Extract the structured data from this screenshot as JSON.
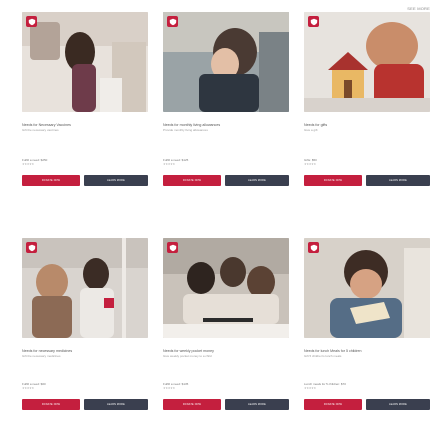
{
  "header": {
    "see_more": "SEE MORE"
  },
  "icons": {
    "badge": "shield-heart-icon"
  },
  "colors": {
    "brand": "#c41f3e",
    "secondary_button": "#3a3f4f"
  },
  "cards": [
    {
      "title": "Needs for Necessary Vaccines",
      "subtitle": "Gift the necessary vaccines",
      "price": "Fulfill a need: $250",
      "stars": "★★★★★",
      "primary": "DONATE NOW",
      "secondary": "LEARN MORE"
    },
    {
      "title": "Needs for monthly living allowances",
      "subtitle": "Provide monthly living allowances",
      "price": "Fulfill a need: $125",
      "stars": "★★★★★",
      "primary": "DONATE NOW",
      "secondary": "LEARN MORE"
    },
    {
      "title": "Needs for gifts",
      "subtitle": "Give a gift",
      "price": "Gifts: $50",
      "stars": "★★★★★",
      "primary": "DONATE NOW",
      "secondary": "LEARN MORE"
    },
    {
      "title": "Needs for necessary medicines",
      "subtitle": "Gift the necessary medicines",
      "price": "Fulfill a need: $60",
      "stars": "★★★★★",
      "primary": "DONATE NOW",
      "secondary": "LEARN MORE"
    },
    {
      "title": "Needs for weekly pocket money",
      "subtitle": "Give weekly pocket money to a child",
      "price": "Fulfill a need: $135",
      "stars": "★★★★★",
      "primary": "DONATE NOW",
      "secondary": "LEARN MORE"
    },
    {
      "title": "Needs for lunch Meals for 5 children",
      "subtitle": "Gift 5 children's lunch meals",
      "price": "Lunch meals for 5 children: $70",
      "stars": "★★★★★",
      "primary": "DONATE NOW",
      "secondary": "LEARN MORE"
    }
  ]
}
